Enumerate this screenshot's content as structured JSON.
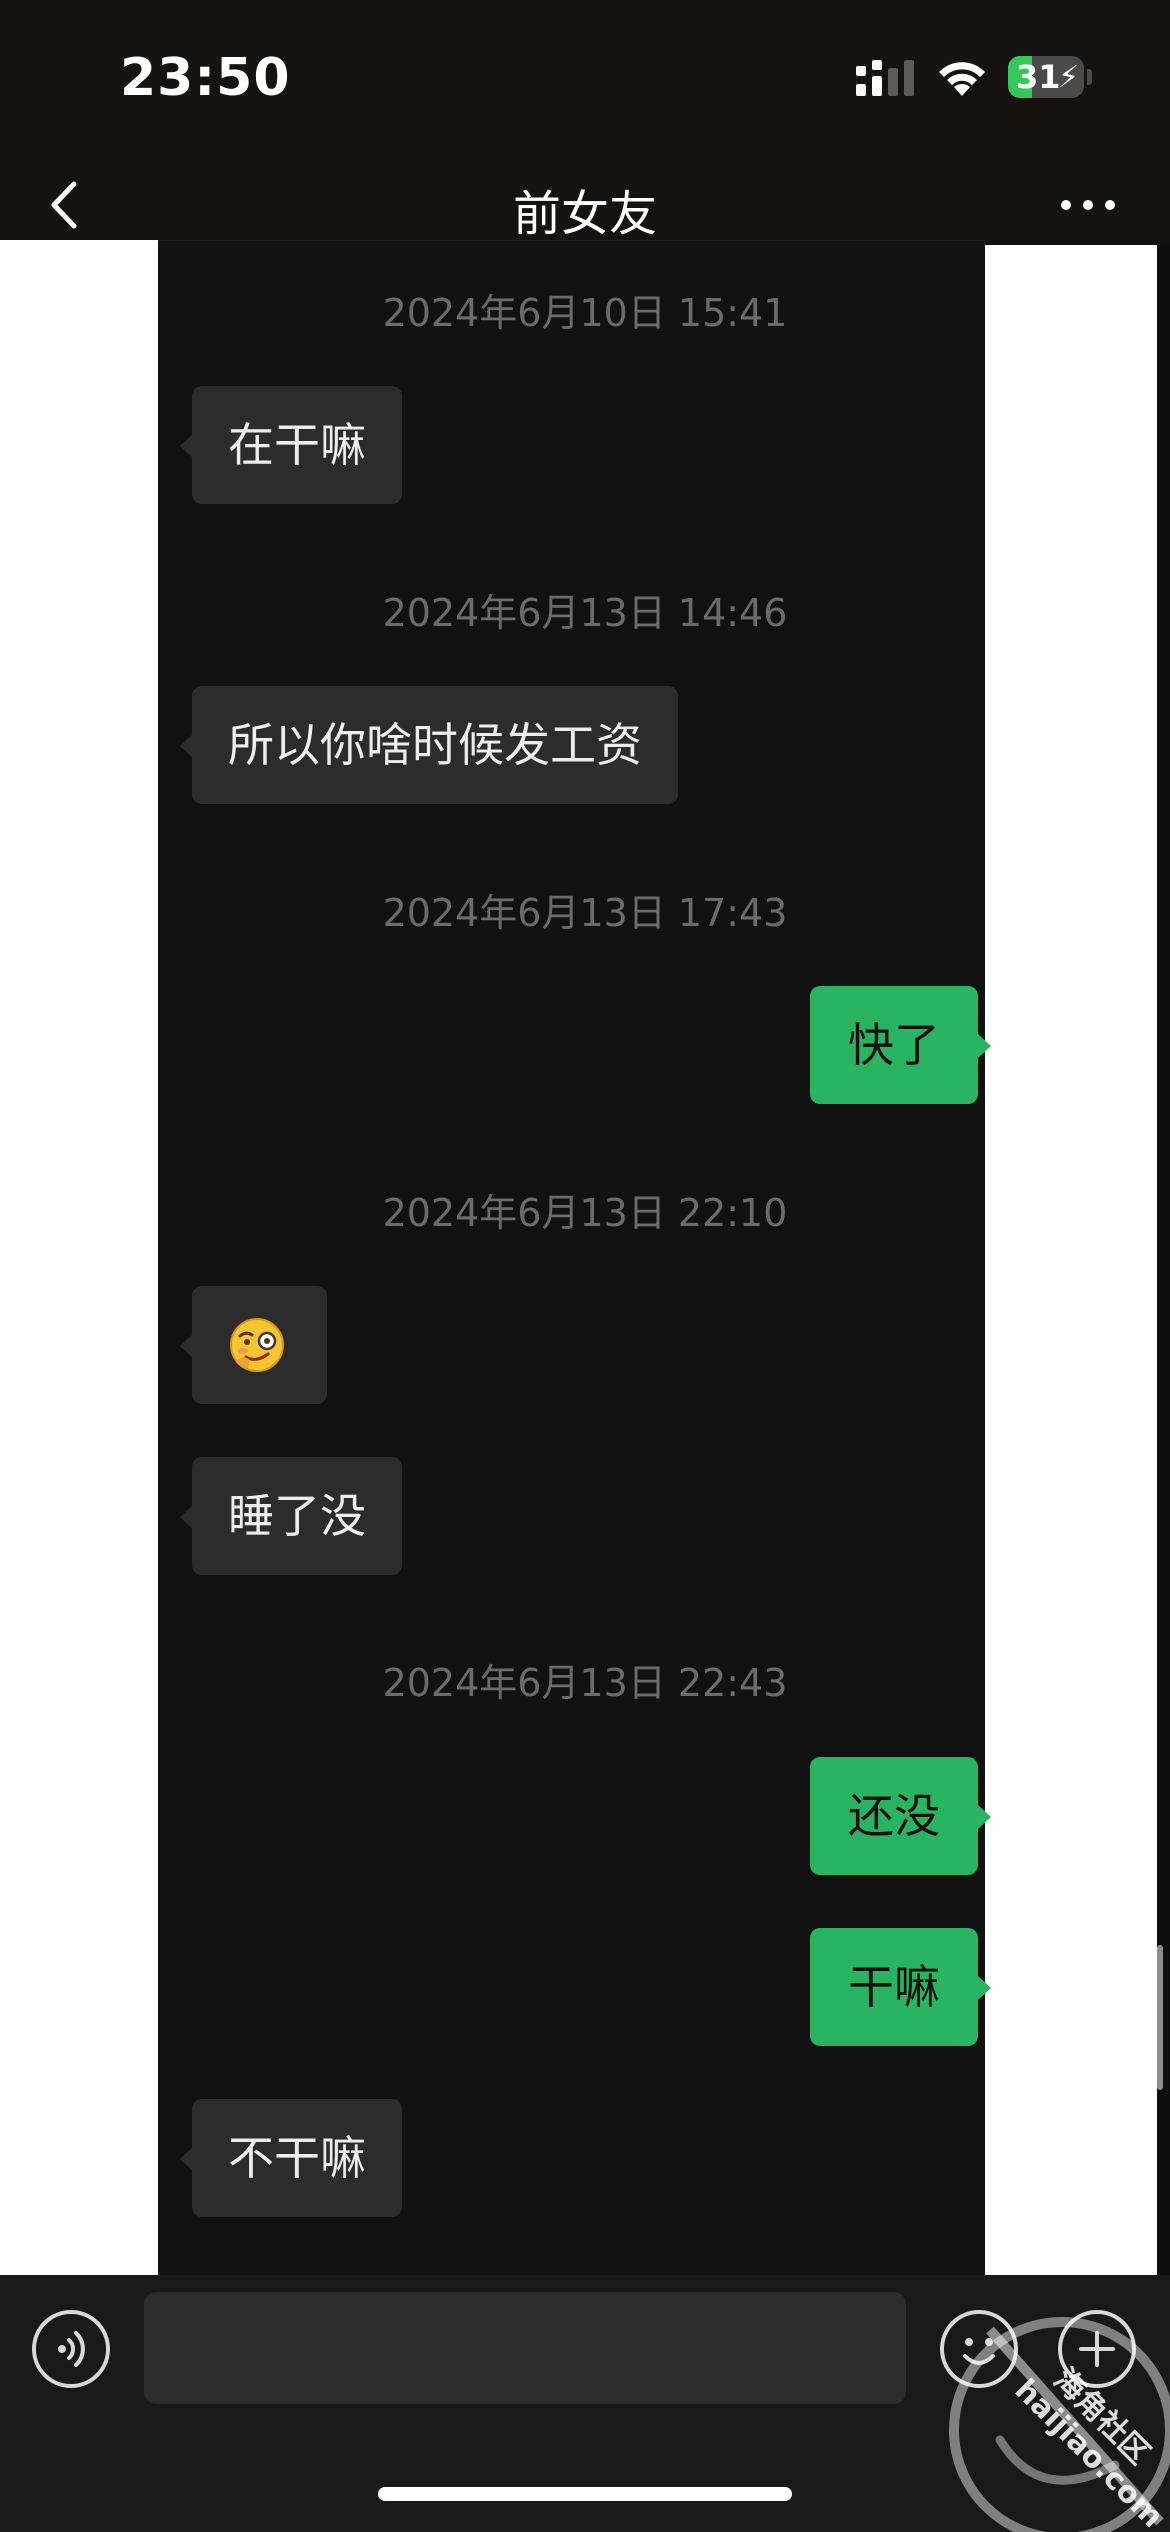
{
  "status_bar": {
    "time": "23:50",
    "battery_level": "31",
    "battery_fraction": 0.31
  },
  "nav": {
    "title": "前女友",
    "back_icon": "chevron-left-icon",
    "more_icon": "ellipsis-icon"
  },
  "messages": [
    {
      "type": "timestamp",
      "text": "2024年6月10日 15:41"
    },
    {
      "type": "in",
      "text": "在干嘛"
    },
    {
      "type": "timestamp",
      "text": "2024年6月13日 14:46"
    },
    {
      "type": "in",
      "text": "所以你啥时候发工资"
    },
    {
      "type": "timestamp",
      "text": "2024年6月13日 17:43"
    },
    {
      "type": "out",
      "text": "快了"
    },
    {
      "type": "timestamp",
      "text": "2024年6月13日 22:10"
    },
    {
      "type": "in",
      "text": "",
      "emoji": "smirking-monocle-emoji"
    },
    {
      "type": "in",
      "text": "睡了没"
    },
    {
      "type": "timestamp",
      "text": "2024年6月13日 22:43"
    },
    {
      "type": "out",
      "text": "还没"
    },
    {
      "type": "out",
      "text": "干嘛"
    },
    {
      "type": "in",
      "text": "不干嘛"
    }
  ],
  "input": {
    "placeholder": "",
    "value": "",
    "voice_icon": "voice-icon",
    "emoji_icon": "emoji-icon",
    "plus_icon": "plus-icon"
  },
  "watermark": {
    "text_cn": "海角社区",
    "text_url": "haijiao.com"
  },
  "colors": {
    "outgoing_bubble": "#29b462",
    "incoming_bubble": "#2c2c2c",
    "chat_background": "#111111",
    "timestamp_text": "#6b6b6b"
  }
}
